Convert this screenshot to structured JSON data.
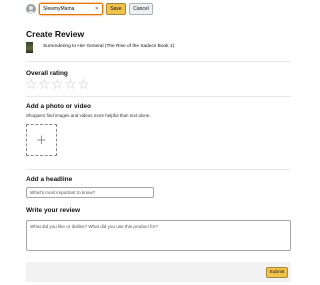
{
  "topbar": {
    "public_name_value": "SlewmyMama",
    "clear_icon": "✕",
    "save_label": "Save",
    "cancel_label": "Cancel"
  },
  "page": {
    "title": "Create Review"
  },
  "product": {
    "title": "Surrendering to Her General (The Rise of the Sadecs Book 1)"
  },
  "rating": {
    "label": "Overall rating",
    "max_stars": 5,
    "selected": 0,
    "star_glyph": "☆"
  },
  "photo": {
    "label": "Add a photo or video",
    "subtext": "Shoppers find images and videos more helpful than text alone.",
    "add_icon": "+"
  },
  "headline": {
    "label": "Add a headline",
    "placeholder": "What's most important to know?"
  },
  "review": {
    "label": "Write your review",
    "placeholder": "What did you like or dislike? What did you use this product for?"
  },
  "footer": {
    "submit_label": "Submit"
  },
  "colors": {
    "button_primary": "#f0c14b",
    "focus_ring": "#e77600",
    "star_empty": "#c8c8c8"
  }
}
